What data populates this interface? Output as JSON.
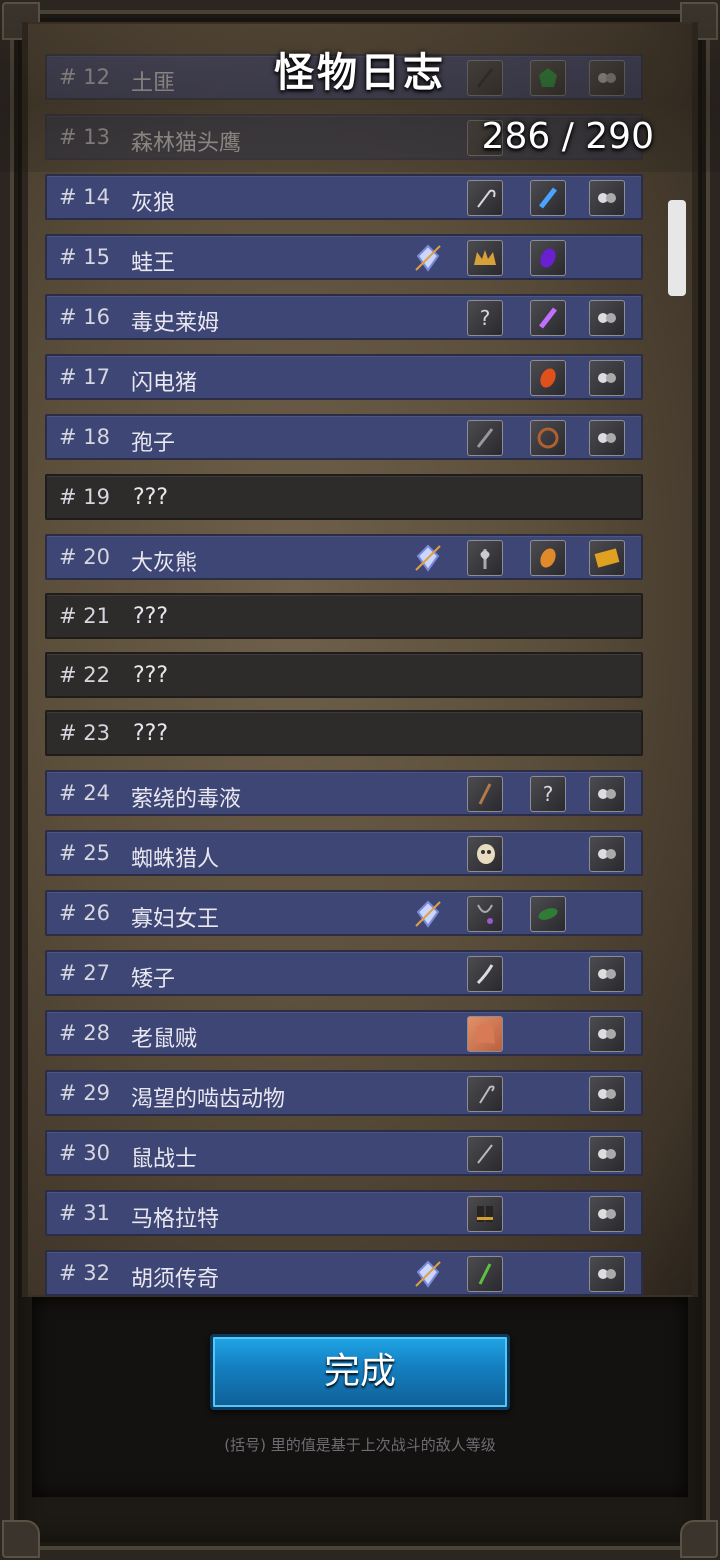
{
  "header": {
    "title": "怪物日志",
    "counter": "286 / 290"
  },
  "rows": [
    {
      "num": "# 12",
      "name": "土匪",
      "known": true
    },
    {
      "num": "# 13",
      "name": "森林猫头鹰",
      "known": true
    },
    {
      "num": "# 14",
      "name": "灰狼",
      "known": true
    },
    {
      "num": "# 15",
      "name": "蛙王",
      "known": true
    },
    {
      "num": "# 16",
      "name": "毒史莱姆",
      "known": true
    },
    {
      "num": "# 17",
      "name": "闪电猪",
      "known": true
    },
    {
      "num": "# 18",
      "name": "孢子",
      "known": true
    },
    {
      "num": "# 19",
      "name": "???",
      "known": false
    },
    {
      "num": "# 20",
      "name": "大灰熊",
      "known": true
    },
    {
      "num": "# 21",
      "name": "???",
      "known": false
    },
    {
      "num": "# 22",
      "name": "???",
      "known": false
    },
    {
      "num": "# 23",
      "name": "???",
      "known": false
    },
    {
      "num": "# 24",
      "name": "萦绕的毒液",
      "known": true
    },
    {
      "num": "# 25",
      "name": "蜘蛛猎人",
      "known": true
    },
    {
      "num": "# 26",
      "name": "寡妇女王",
      "known": true
    },
    {
      "num": "# 27",
      "name": "矮子",
      "known": true
    },
    {
      "num": "# 28",
      "name": "老鼠贼",
      "known": true
    },
    {
      "num": "# 29",
      "name": "渴望的啮齿动物",
      "known": true
    },
    {
      "num": "# 30",
      "name": "鼠战士",
      "known": true
    },
    {
      "num": "# 31",
      "name": "马格拉特",
      "known": true
    },
    {
      "num": "# 32",
      "name": "胡须传奇",
      "known": true
    }
  ],
  "unknown_slot_glyph": "?",
  "done_button": "完成",
  "footnote": "(括号) 里的值是基于上次战斗的敌人等级",
  "colors": {
    "row_known": "#3e4675",
    "row_unknown": "#2e2c2a",
    "button": "#1581c3"
  }
}
